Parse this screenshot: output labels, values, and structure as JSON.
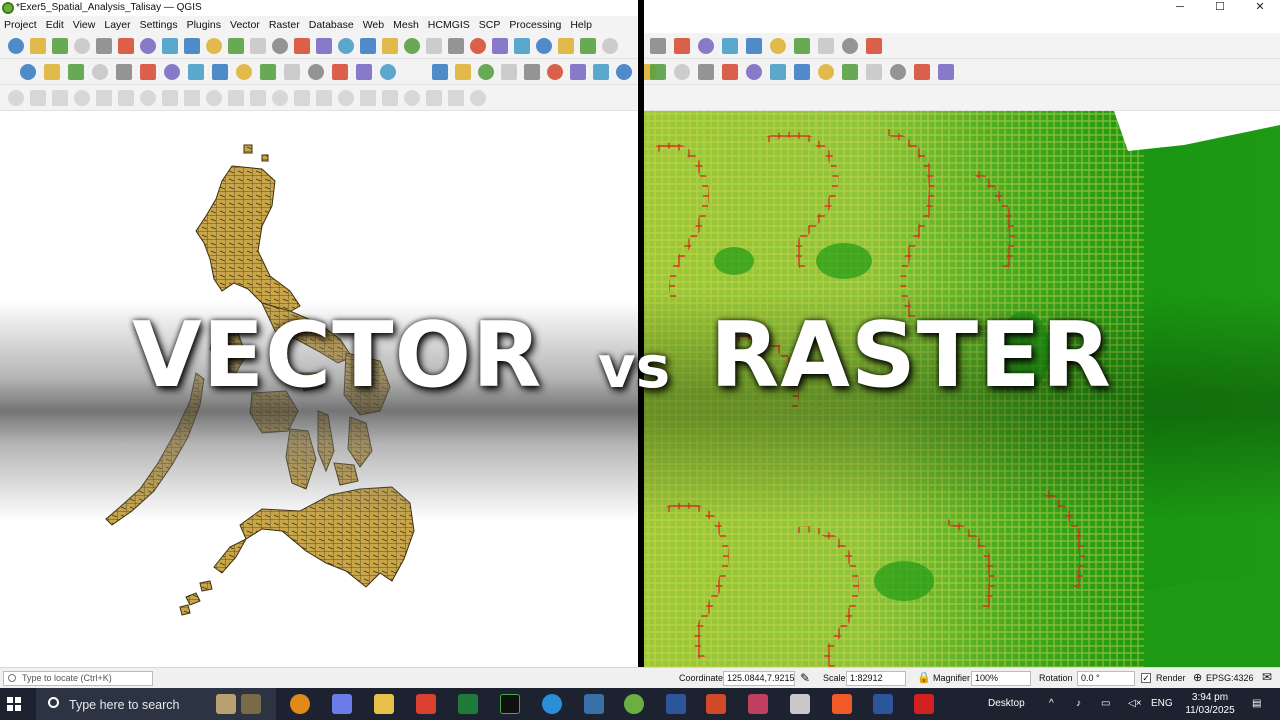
{
  "window": {
    "title": "*Exer5_Spatial_Analysis_Talisay — QGIS",
    "controls": [
      "─",
      "☐",
      "✕"
    ]
  },
  "menu": [
    "Project",
    "Edit",
    "View",
    "Layer",
    "Settings",
    "Plugins",
    "Vector",
    "Raster",
    "Database",
    "Web",
    "Mesh",
    "HCMGIS",
    "SCP",
    "Processing",
    "Help"
  ],
  "headline": {
    "left": "VECTOR",
    "middle": "vs",
    "right": "RASTER"
  },
  "statusbar": {
    "locate_placeholder": "Type to locate (Ctrl+K)",
    "coordinate_label": "Coordinate",
    "coordinate_value": "125.0844,7.9215",
    "scale_label": "Scale",
    "scale_value": "1:82912",
    "magnifier_label": "Magnifier",
    "magnifier_value": "100%",
    "rotation_label": "Rotation",
    "rotation_value": "0.0 °",
    "render_label": "Render",
    "render_checked": "✓",
    "crs": "EPSG:4326"
  },
  "taskbar": {
    "search_placeholder": "Type here to search",
    "desktop_label": "Desktop",
    "language": "ENG",
    "time": "3:94 pm",
    "date": "11/03/2025"
  },
  "colors": {
    "vector_fill": "#c9a64a",
    "vector_stroke": "#3a2f12",
    "raster_green": "#1f9a15",
    "raster_yellow": "#d9d94a",
    "raster_red": "#d9281c"
  }
}
